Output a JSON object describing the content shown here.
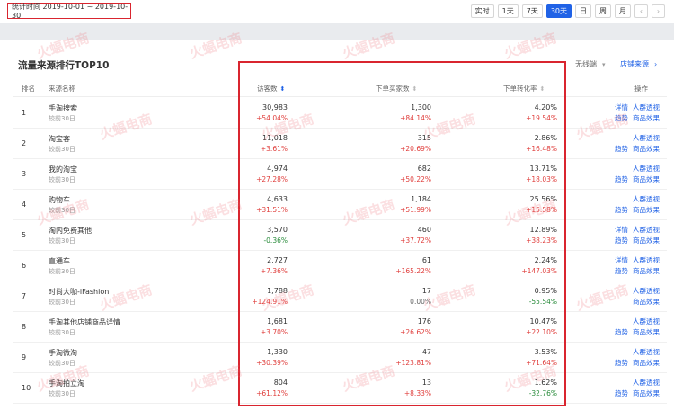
{
  "header": {
    "period_text": "统计时间 2019-10-01 ~ 2019-10-30",
    "ranges": [
      "实时",
      "1天",
      "7天",
      "30天",
      "日",
      "周",
      "月"
    ],
    "active_range": "30天",
    "prev_icon": "chevron-left-icon",
    "next_icon": "chevron-right-icon"
  },
  "panel": {
    "title": "流量来源排行TOP10",
    "mode_label": "无线端",
    "shop_source_label": "店铺来源",
    "columns": [
      "排名",
      "来源名称",
      "访客数",
      "下单买家数",
      "下单转化率",
      "操作"
    ],
    "rows": [
      {
        "rank": "1",
        "name": "手淘搜索",
        "sub": "较前30日",
        "visitors": "30,983",
        "visitors_chg": "+54.04%",
        "buyers": "1,300",
        "buyers_chg": "+84.14%",
        "conv": "4.20%",
        "conv_chg": "+19.54%",
        "ops": [
          "详情",
          "人群透视",
          "趋势",
          "商品效果"
        ]
      },
      {
        "rank": "2",
        "name": "淘宝客",
        "sub": "较前30日",
        "visitors": "11,018",
        "visitors_chg": "+3.61%",
        "buyers": "315",
        "buyers_chg": "+20.69%",
        "conv": "2.86%",
        "conv_chg": "+16.48%",
        "ops": [
          "人群透视",
          "趋势",
          "商品效果"
        ]
      },
      {
        "rank": "3",
        "name": "我的淘宝",
        "sub": "较前30日",
        "visitors": "4,974",
        "visitors_chg": "+27.28%",
        "buyers": "682",
        "buyers_chg": "+50.22%",
        "conv": "13.71%",
        "conv_chg": "+18.03%",
        "ops": [
          "人群透视",
          "趋势",
          "商品效果"
        ]
      },
      {
        "rank": "4",
        "name": "购物车",
        "sub": "较前30日",
        "visitors": "4,633",
        "visitors_chg": "+31.51%",
        "buyers": "1,184",
        "buyers_chg": "+51.99%",
        "conv": "25.56%",
        "conv_chg": "+15.58%",
        "ops": [
          "人群透视",
          "趋势",
          "商品效果"
        ]
      },
      {
        "rank": "5",
        "name": "淘内免费其他",
        "sub": "较前30日",
        "visitors": "3,570",
        "visitors_chg": "-0.36%",
        "buyers": "460",
        "buyers_chg": "+37.72%",
        "conv": "12.89%",
        "conv_chg": "+38.23%",
        "ops": [
          "详情",
          "人群透视",
          "趋势",
          "商品效果"
        ]
      },
      {
        "rank": "6",
        "name": "直通车",
        "sub": "较前30日",
        "visitors": "2,727",
        "visitors_chg": "+7.36%",
        "buyers": "61",
        "buyers_chg": "+165.22%",
        "conv": "2.24%",
        "conv_chg": "+147.03%",
        "ops": [
          "详情",
          "人群透视",
          "趋势",
          "商品效果"
        ]
      },
      {
        "rank": "7",
        "name": "时尚大咖-iFashion",
        "sub": "较前30日",
        "visitors": "1,788",
        "visitors_chg": "+124.91%",
        "buyers": "17",
        "buyers_chg": "0.00%",
        "conv": "0.95%",
        "conv_chg": "-55.54%",
        "ops": [
          "人群透视",
          "商品效果"
        ]
      },
      {
        "rank": "8",
        "name": "手淘其他店铺商品详情",
        "sub": "较前30日",
        "visitors": "1,681",
        "visitors_chg": "+3.70%",
        "buyers": "176",
        "buyers_chg": "+26.62%",
        "conv": "10.47%",
        "conv_chg": "+22.10%",
        "ops": [
          "人群透视",
          "趋势",
          "商品效果"
        ]
      },
      {
        "rank": "9",
        "name": "手淘微淘",
        "sub": "较前30日",
        "visitors": "1,330",
        "visitors_chg": "+30.39%",
        "buyers": "47",
        "buyers_chg": "+123.81%",
        "conv": "3.53%",
        "conv_chg": "+71.64%",
        "ops": [
          "人群透视",
          "趋势",
          "商品效果"
        ]
      },
      {
        "rank": "10",
        "name": "手淘拍立淘",
        "sub": "较前30日",
        "visitors": "804",
        "visitors_chg": "+61.12%",
        "buyers": "13",
        "buyers_chg": "+8.33%",
        "conv": "1.62%",
        "conv_chg": "-32.76%",
        "ops": [
          "人群透视",
          "趋势",
          "商品效果"
        ]
      }
    ]
  },
  "watermark_text": "火蝠电商",
  "colors": {
    "accent": "#2062e6",
    "up": "#e0403e",
    "down": "#2a8c3c",
    "highlight": "#d9252f"
  }
}
